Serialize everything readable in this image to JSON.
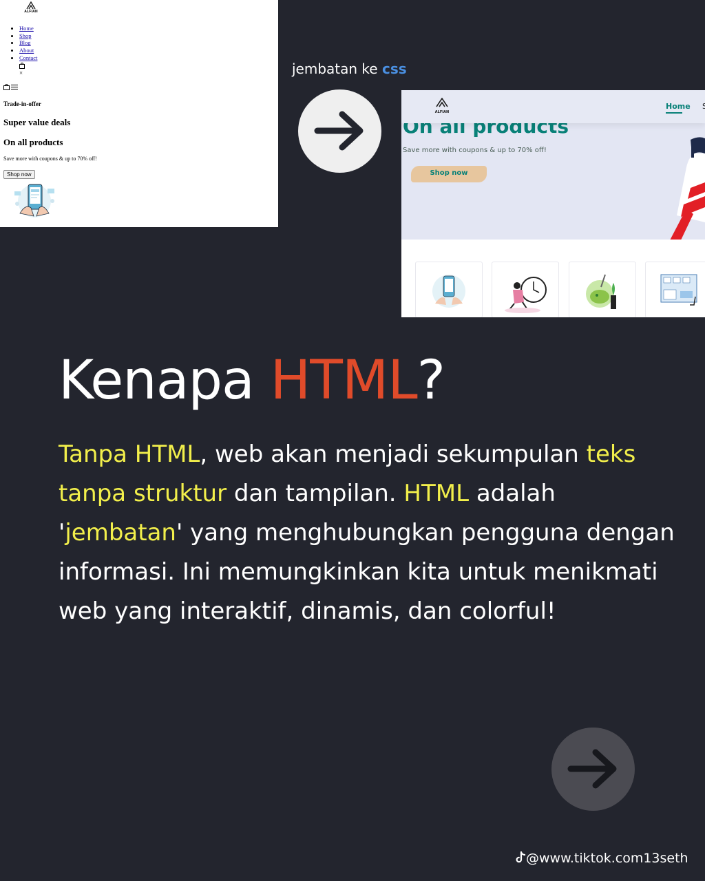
{
  "raw_page": {
    "logo_text": "ALFIAN",
    "nav": [
      "Home",
      "Shop",
      "Blog",
      "About",
      "Contact"
    ],
    "close_symbol": "×",
    "trade_in": "Trade-in-offer",
    "heading2": "Super value deals",
    "heading1": "On all products",
    "paragraph": "Save more with coupons & up to 70% off!",
    "button": "Shop now"
  },
  "caption": {
    "prefix": "jembatan ke",
    "highlight": "css",
    "highlight_color": "#4a90e2"
  },
  "styled_page": {
    "logo_text": "ALFIAN",
    "nav_active": "Home",
    "heading": "On all products",
    "paragraph": "Save more with coupons & up to 70% off!",
    "button": "Shop now",
    "brand_color": "#088178"
  },
  "title": {
    "part1": "Kenapa",
    "accent": "HTML",
    "part2": "?",
    "accent_color": "#e04b2a"
  },
  "body": {
    "s1": "Tanpa HTML",
    "s2": ", web akan menjadi sekumpulan ",
    "s3": "teks tanpa struktur",
    "s4": " dan tampilan. ",
    "s5": "HTML",
    "s6": " adalah '",
    "s7": "jembatan",
    "s8": "' yang menghubungkan pengguna dengan informasi. Ini memungkinkan kita untuk menikmati web yang interaktif, dinamis, dan colorful!",
    "highlight_color": "#f2ef4b"
  },
  "footer": {
    "handle": "@www.tiktok.com13seth",
    "icon": "tiktok-icon"
  },
  "icons": [
    "arrow-right-icon",
    "bag-icon",
    "menu-icon",
    "close-icon",
    "logo-icon"
  ]
}
